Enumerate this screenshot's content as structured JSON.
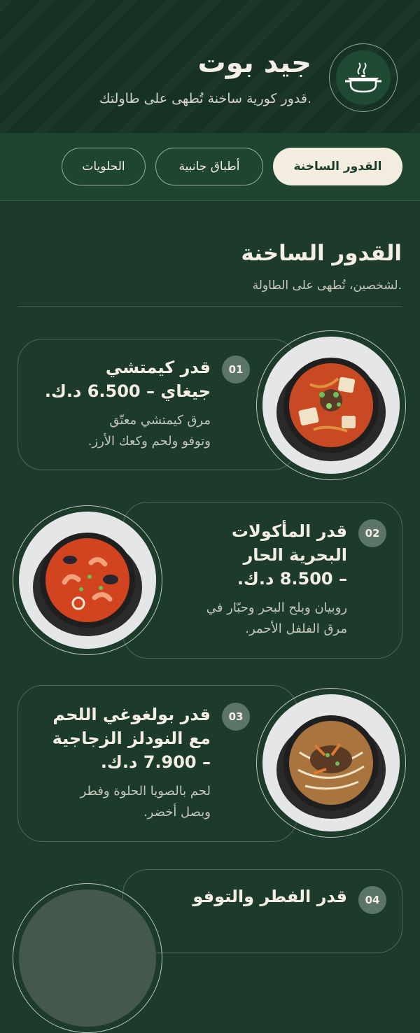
{
  "brand": {
    "title": "جيد بوت",
    "subtitle": "قدور كورية ساخنة تُطهى على طاولتك.",
    "logo_icon": "hot-pot-icon"
  },
  "tabs": [
    {
      "label": "القدور الساخنة",
      "active": true
    },
    {
      "label": "أطباق جانبية",
      "active": false
    },
    {
      "label": "الحلويات",
      "active": false
    }
  ],
  "section": {
    "title": "القدور الساخنة",
    "subtitle": "لشخصين، تُطهى على الطاولة."
  },
  "items": [
    {
      "num": "01",
      "name_line1": "قدر كيمتشي",
      "name_line2": "جيغاي – 6.500 د.ك.",
      "desc_line1": "مرق كيمتشي معتّق",
      "desc_line2": "وتوفو ولحم وكعك الأرز.",
      "image": "kimchi-stew",
      "broth": "#c94a22"
    },
    {
      "num": "02",
      "name_line1": "قدر المأكولات",
      "name_line2": "البحرية الحار",
      "name_line3": "– 8.500 د.ك.",
      "desc_line1": "روبيان وبلح البحر وحبّار في",
      "desc_line2": "مرق الفلفل الأحمر.",
      "image": "spicy-seafood-stew",
      "broth": "#d2431f"
    },
    {
      "num": "03",
      "name_line1": "قدر بولغوغي اللحم",
      "name_line2": "مع النودلز الزجاجية",
      "name_line3": "– 7.900 د.ك.",
      "desc_line1": "لحم بالصويا الحلوة وفطر",
      "desc_line2": "وبصل أخضر.",
      "image": "bulgogi-noodle-pot",
      "broth": "#a9743e"
    },
    {
      "num": "04",
      "name_line1": "قدر الفطر والتوفو"
    }
  ]
}
